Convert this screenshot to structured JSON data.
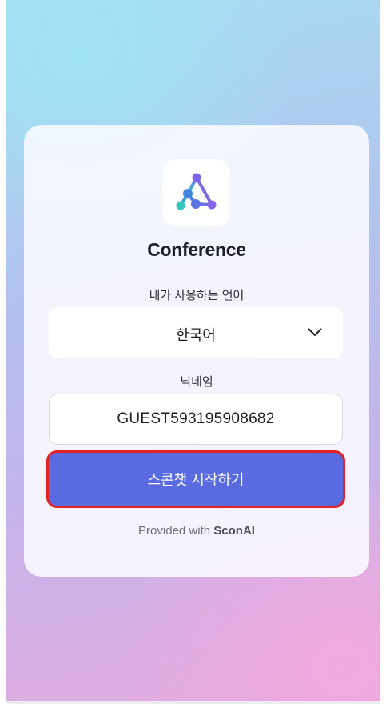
{
  "app": {
    "title": "Conference",
    "logo_icon": "network-triangle-icon"
  },
  "language": {
    "label": "내가 사용하는 언어",
    "selected": "한국어"
  },
  "nickname": {
    "label": "닉네임",
    "value": "GUEST593195908682"
  },
  "start_button": {
    "label": "스콘챗 시작하기"
  },
  "footer": {
    "prefix": "Provided with",
    "brand": "SconAI"
  },
  "colors": {
    "accent": "#5a6ae0",
    "highlight": "#e52222"
  }
}
